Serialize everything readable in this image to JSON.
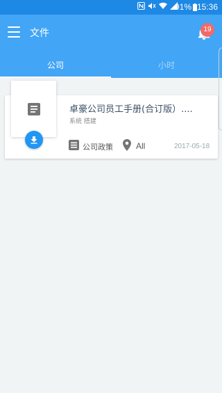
{
  "status_bar": {
    "battery": "91%",
    "time": "15:36",
    "icons": [
      "nfc-icon",
      "mute-icon",
      "wifi-icon",
      "signal-icon",
      "battery-icon"
    ]
  },
  "app_bar": {
    "title": "文件",
    "notification_count": "19",
    "color": "#42a5f5"
  },
  "tabs": [
    {
      "label": "公司",
      "active": true
    },
    {
      "label": "小时",
      "active": false
    }
  ],
  "documents": [
    {
      "title": "卓豪公司员工手册(合订版）....",
      "subtitle": "系统 搭建",
      "category": "公司政策",
      "location": "All",
      "date": "2017-05-18"
    }
  ],
  "colors": {
    "accent": "#2196f3",
    "badge": "#ef6b6b",
    "status_bar": "#1e88e5"
  }
}
